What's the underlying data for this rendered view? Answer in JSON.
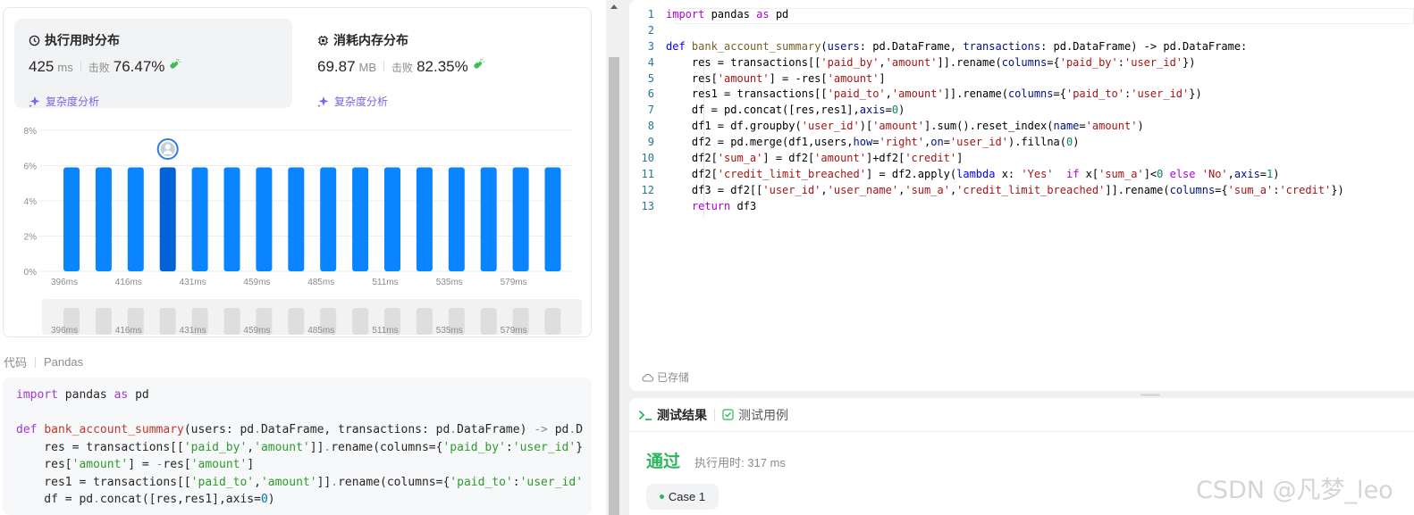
{
  "stats": {
    "runtime": {
      "title": "执行用时分布",
      "value": "425",
      "unit": "ms",
      "beat_label": "击败",
      "beat": "76.47%",
      "complexity_link": "复杂度分析"
    },
    "memory": {
      "title": "消耗内存分布",
      "value": "69.87",
      "unit": "MB",
      "beat_label": "击败",
      "beat": "82.35%",
      "complexity_link": "复杂度分析"
    }
  },
  "chart_data": {
    "type": "bar",
    "ylabel": "",
    "ylim": [
      0,
      8
    ],
    "y_ticks": [
      "8%",
      "6%",
      "4%",
      "2%",
      "0%"
    ],
    "x_tick_labels": [
      "396ms",
      "416ms",
      "431ms",
      "459ms",
      "485ms",
      "511ms",
      "535ms",
      "579ms"
    ],
    "values": [
      5.9,
      5.9,
      5.9,
      5.9,
      5.9,
      5.9,
      5.9,
      5.9,
      5.9,
      5.9,
      5.9,
      5.9,
      5.9,
      5.9,
      5.9,
      5.9
    ],
    "highlight_index": 3,
    "bar_color": "#0a84ff",
    "highlight_color": "#0062d6",
    "grid": true
  },
  "code_section": {
    "label": "代码",
    "language": "Pandas"
  },
  "editor": {
    "saved_label": "已存储"
  },
  "results": {
    "tab_results": "测试结果",
    "tab_cases": "测试用例",
    "status": "通过",
    "exec_time": "执行用时: 317 ms",
    "case_label": "Case 1"
  },
  "watermark": "CSDN @凡梦_leo",
  "colors": {
    "accent_purple": "#7c63e8",
    "pass_green": "#2db55d",
    "bar_blue": "#0a84ff"
  }
}
